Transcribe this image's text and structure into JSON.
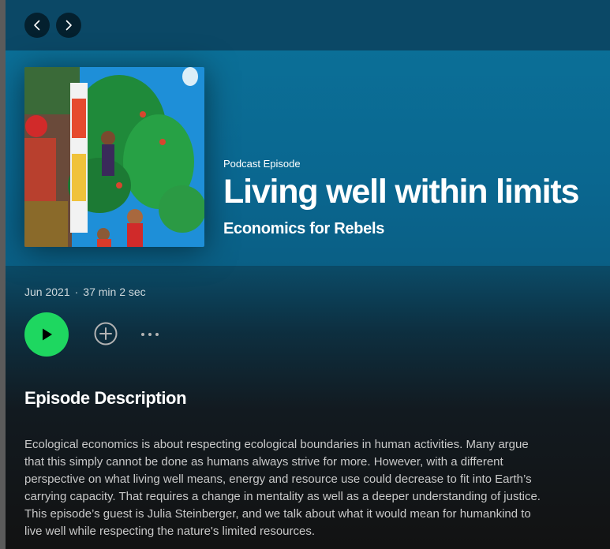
{
  "nav": {
    "back_icon": "chevron-left-icon",
    "forward_icon": "chevron-right-icon"
  },
  "episode": {
    "type_label": "Podcast Episode",
    "title": "Living well within limits",
    "show_name": "Economics for Rebels",
    "date": "Jun 2021",
    "separator": "·",
    "duration": "37 min 2 sec"
  },
  "actions": {
    "play_icon": "play-icon",
    "add_icon": "plus-circle-icon",
    "more_icon": "more-horizontal-icon"
  },
  "description": {
    "heading": "Episode Description",
    "text": "Ecological economics is about respecting ecological boundaries in human activities. Many argue that this simply cannot be done as humans always strive for more. However, with a different perspective on what living well means, energy and resource use could decrease to fit into Earth’s carrying capacity. That requires a change in mentality as well as a deeper understanding of justice. This episode’s guest is Julia Steinberger, and we talk about what it would mean for humankind to live well while respecting the nature's limited resources."
  },
  "colors": {
    "accent": "#1ed760",
    "hero_background": "#0a6790",
    "page_background": "#121212"
  }
}
